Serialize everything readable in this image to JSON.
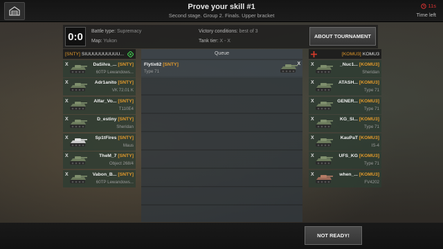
{
  "header": {
    "title": "Prove your skill #1",
    "subtitle": "Second stage. Group 2. Finals. Upper bracket",
    "timer": "11s",
    "timer_label": "Time left"
  },
  "info": {
    "score": "0:0",
    "battle_type_label": "Battle type:",
    "battle_type_value": "Supremacy",
    "map_label": "Map:",
    "map_value": "Yukon",
    "victory_label": "Victory conditions:",
    "victory_value": "best of 3",
    "tier_label": "Tank tier:",
    "tier_value": "X - X",
    "about_button": "ABOUT TOURNAMENT"
  },
  "left_team": {
    "tag": "[SNTY]",
    "name": "SIUUUUUUUUUU...",
    "icon": "green-diamond-icon",
    "players": [
      {
        "x": "X",
        "name": "DaSilva_...",
        "tag": "[SNTY]",
        "vehicle": "60TP Lewandows..."
      },
      {
        "x": "X",
        "name": "Adr1anito",
        "tag": "[SNTY]",
        "vehicle": "VK 72.01 K"
      },
      {
        "x": "X",
        "name": "Alfar_Vo...",
        "tag": "[SNTY]",
        "vehicle": "T110E4"
      },
      {
        "x": "X",
        "name": "D_estiny",
        "tag": "[SNTY]",
        "vehicle": "Sheridan"
      },
      {
        "x": "X",
        "name": "Sp1tFires",
        "tag": "[SNTY]",
        "vehicle": "Maus"
      },
      {
        "x": "X",
        "name": "TheM_7",
        "tag": "[SNTY]",
        "vehicle": "Object 268/4"
      },
      {
        "x": "X",
        "name": "Vabon_B...",
        "tag": "[SNTY]",
        "vehicle": "60TP Lewandows..."
      }
    ]
  },
  "right_team": {
    "tag": "[KOMU3]",
    "name": "KOMU3",
    "icon": "red-cross-icon",
    "players": [
      {
        "x": "X",
        "name": "_Nuc1...",
        "tag": "[KOMU3]",
        "vehicle": "Sheridan"
      },
      {
        "x": "X",
        "name": "ATASH...",
        "tag": "[KOMU3]",
        "vehicle": "Type 71"
      },
      {
        "x": "X",
        "name": "GENER...",
        "tag": "[KOMU3]",
        "vehicle": "Type 71"
      },
      {
        "x": "X",
        "name": "KG_Sl...",
        "tag": "[KOMU3]",
        "vehicle": "Type 71"
      },
      {
        "x": "X",
        "name": "KauPaT",
        "tag": "[KOMU3]",
        "vehicle": "IS-4"
      },
      {
        "x": "X",
        "name": "UFS_KG",
        "tag": "[KOMU3]",
        "vehicle": "Type 71"
      },
      {
        "x": "X",
        "name": "when_...",
        "tag": "[KOMU3]",
        "vehicle": "FV4202"
      }
    ]
  },
  "queue": {
    "header": "Queue",
    "items": [
      {
        "name": "Flytix62",
        "tag": "[SNTY]",
        "vehicle": "Type 71",
        "x": "X"
      }
    ]
  },
  "footer": {
    "not_ready_button": "NOT READY!"
  },
  "colors": {
    "clan_tag": "#e39a2b",
    "timer": "#dd3333",
    "left_row": "#2d3c32",
    "right_row": "#2d3c32"
  }
}
